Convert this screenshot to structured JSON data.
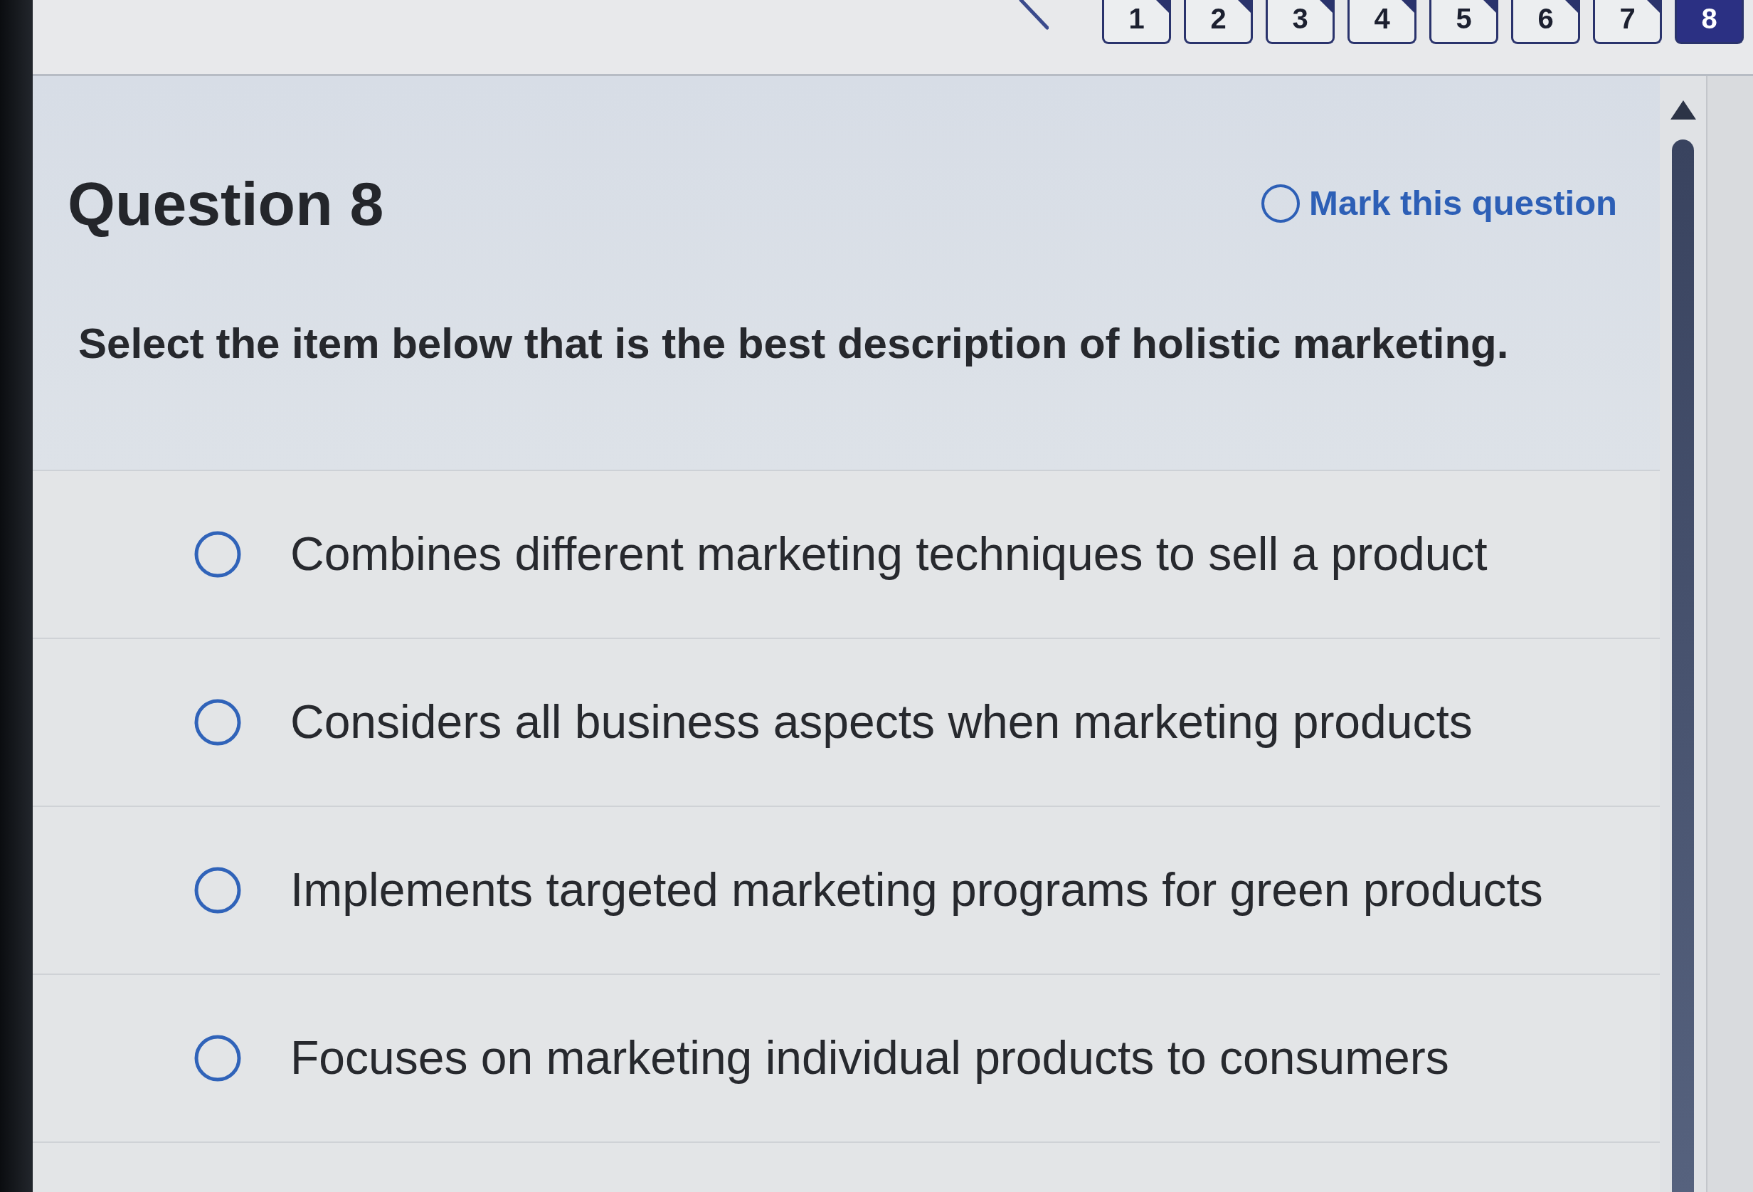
{
  "question_nav": {
    "pages": [
      {
        "label": "1",
        "selected": false,
        "corner_mark": true
      },
      {
        "label": "2",
        "selected": false,
        "corner_mark": true
      },
      {
        "label": "3",
        "selected": false,
        "corner_mark": true
      },
      {
        "label": "4",
        "selected": false,
        "corner_mark": true
      },
      {
        "label": "5",
        "selected": false,
        "corner_mark": true
      },
      {
        "label": "6",
        "selected": false,
        "corner_mark": true
      },
      {
        "label": "7",
        "selected": false,
        "corner_mark": true
      },
      {
        "label": "8",
        "selected": true,
        "corner_mark": false
      }
    ]
  },
  "question": {
    "title": "Question 8",
    "mark_toggle": {
      "label": "Mark this question",
      "marked": false
    },
    "prompt": "Select the item below that is the best description of holistic marketing.",
    "options": [
      {
        "label": "Combines different marketing techniques to sell a product",
        "selected": false
      },
      {
        "label": "Considers all business aspects when marketing products",
        "selected": false
      },
      {
        "label": "Implements targeted marketing programs for green products",
        "selected": false
      },
      {
        "label": "Focuses on marketing individual products to consumers",
        "selected": false
      }
    ]
  }
}
